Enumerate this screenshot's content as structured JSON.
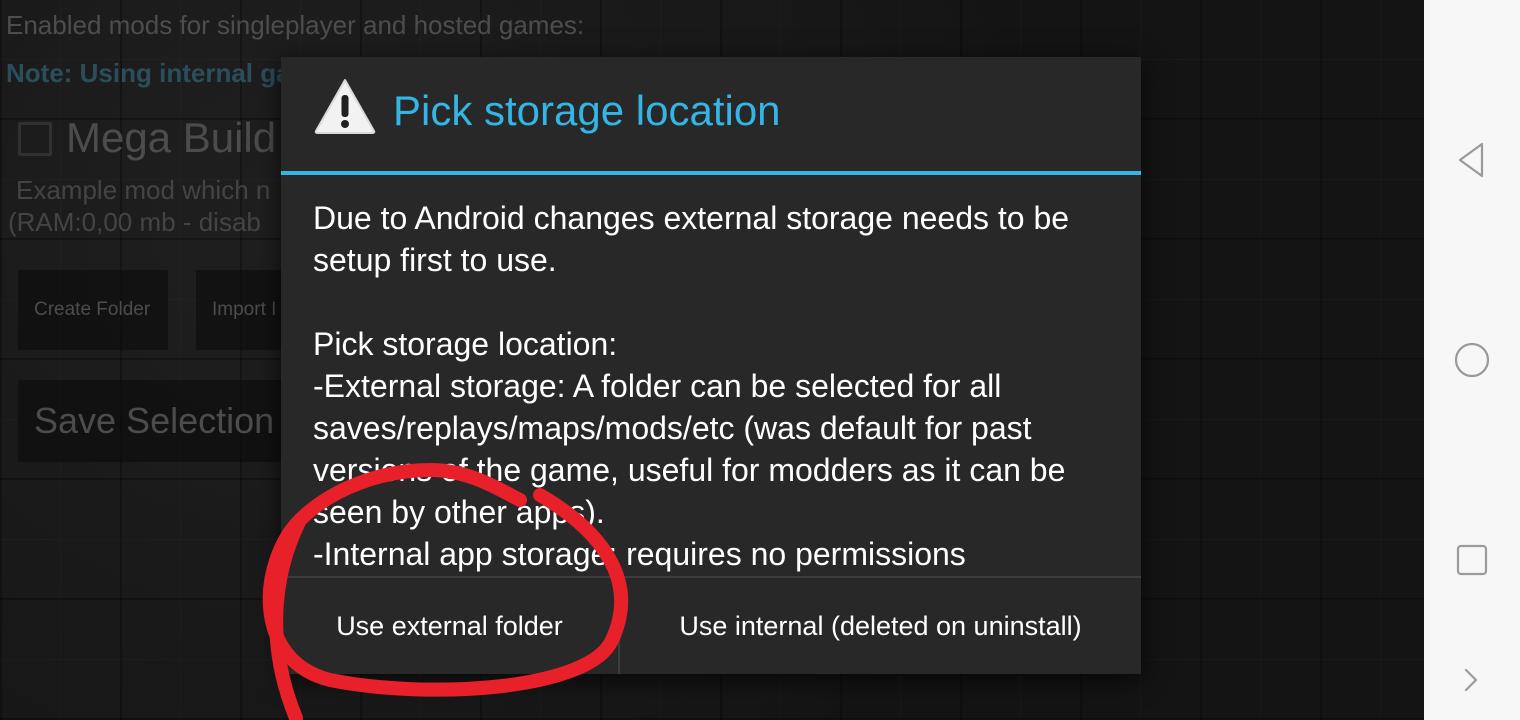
{
  "background_app": {
    "header": "Enabled mods for singleplayer and hosted games:",
    "note": "Note: Using internal ga",
    "mod_name": "Mega Build",
    "mod_description": "Example mod which n",
    "mod_ram": "(RAM:0,00 mb - disab",
    "create_folder_button": "Create Folder",
    "import_button": "Import I",
    "save_selection_button": "Save Selection"
  },
  "dialog": {
    "icon": "warning-icon",
    "title": "Pick storage location",
    "accent_color": "#33b5e5",
    "body_paragraph_1": "Due to Android changes external storage needs to be setup first to use.",
    "body_paragraph_2": "Pick storage location:\n-External storage: A folder can be selected for all saves/replays/maps/mods/etc (was default for past versions of the game, useful for modders as it can be seen by other apps).\n-Internal app storage: requires no permissions",
    "buttons": {
      "external": "Use external folder",
      "internal": "Use internal (deleted on uninstall)"
    }
  },
  "annotation": {
    "color": "#e8202a",
    "shape": "hand-drawn-circle"
  },
  "navbar": {
    "icons": [
      "back-icon",
      "home-icon",
      "recents-icon",
      "expand-icon"
    ]
  }
}
